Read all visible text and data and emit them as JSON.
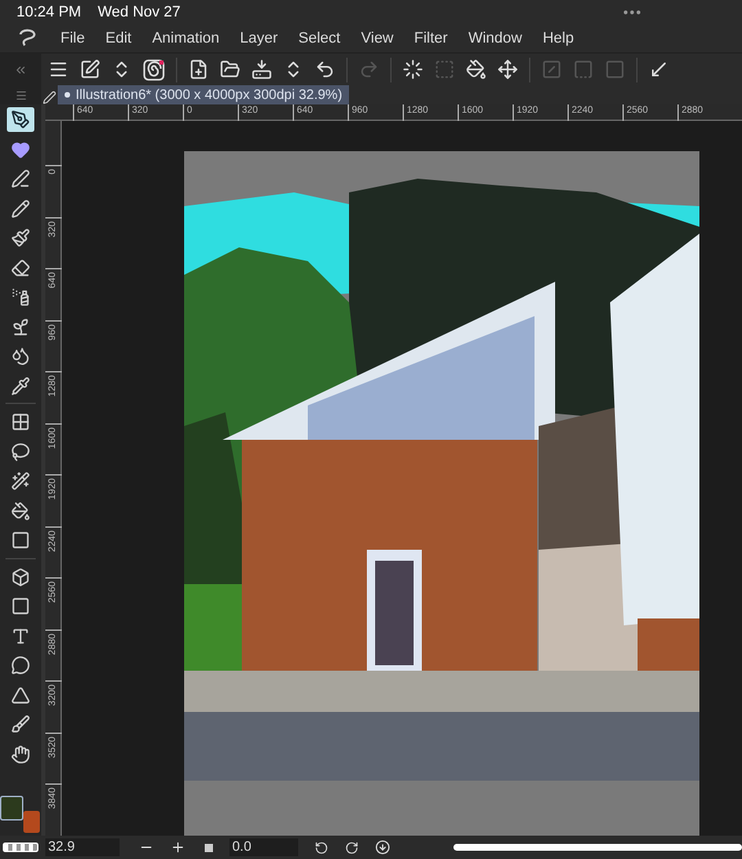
{
  "status_bar": {
    "time": "10:24 PM",
    "date": "Wed Nov 27"
  },
  "menu": [
    "File",
    "Edit",
    "Animation",
    "Layer",
    "Select",
    "View",
    "Filter",
    "Window",
    "Help"
  ],
  "toolbar": [
    {
      "disabled": false
    },
    {
      "disabled": false
    },
    {
      "disabled": false
    },
    {
      "disabled": false
    },
    {
      "disabled": false
    },
    {
      "disabled": false
    },
    {
      "disabled": false
    },
    {
      "disabled": false
    },
    {
      "disabled": false
    },
    {
      "disabled": true
    },
    {
      "disabled": false
    },
    {
      "disabled": true
    },
    {
      "disabled": false
    },
    {
      "disabled": false
    },
    {
      "disabled": true
    },
    {
      "disabled": true
    },
    {
      "disabled": true
    },
    {
      "disabled": false
    }
  ],
  "document_tab": {
    "label": "Illustration6* (3000 x 4000px 300dpi 32.9%)",
    "selected": true
  },
  "ruler_horizontal": [
    "640",
    "320",
    "0",
    "320",
    "640",
    "960",
    "1280",
    "1600",
    "1920",
    "2240",
    "2560",
    "2880"
  ],
  "ruler_vertical": [
    "0",
    "320",
    "640",
    "960",
    "1280",
    "1600",
    "1920",
    "2240",
    "2560",
    "2880",
    "3200",
    "3520",
    "3840"
  ],
  "tools": [
    {
      "selected": true
    },
    {
      "selected": false
    },
    {
      "selected": false
    },
    {
      "selected": false
    },
    {
      "selected": false
    },
    {
      "selected": false
    },
    {
      "selected": false
    },
    {
      "selected": false
    },
    {
      "selected": false
    },
    {
      "selected": false
    },
    {
      "selected": false
    },
    {
      "selected": false
    },
    {
      "selected": false
    },
    {
      "selected": false
    },
    {
      "selected": false
    },
    {
      "selected": false
    },
    {
      "selected": false
    },
    {
      "selected": false
    },
    {
      "selected": false
    },
    {
      "selected": false
    },
    {
      "selected": false
    },
    {
      "selected": false
    }
  ],
  "colors": {
    "main": {
      "color": "#2c3a1d"
    },
    "sub": {
      "color": "#b4491d"
    }
  },
  "bottom_bar": {
    "zoom": "32.9",
    "rotation": "0.0"
  }
}
